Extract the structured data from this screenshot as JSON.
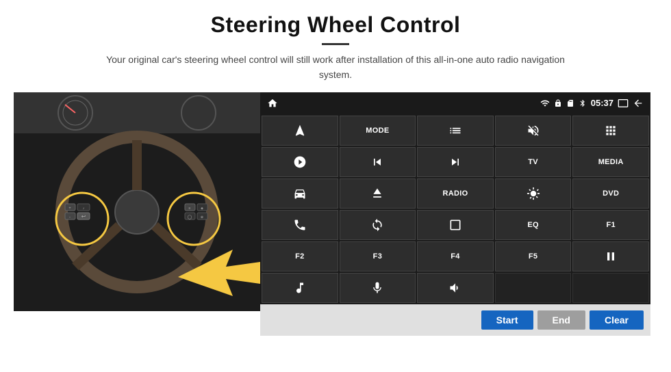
{
  "header": {
    "title": "Steering Wheel Control",
    "divider": true,
    "subtitle": "Your original car's steering wheel control will still work after installation of this all-in-one auto radio navigation system."
  },
  "status_bar": {
    "home_icon": "⌂",
    "wifi_icon": "▲",
    "lock_icon": "🔒",
    "sd_icon": "▣",
    "bt_icon": "₿",
    "time": "05:37",
    "screen_icon": "▬",
    "back_icon": "↩"
  },
  "button_rows": [
    [
      {
        "type": "icon",
        "icon": "navigate",
        "label": ""
      },
      {
        "type": "text",
        "label": "MODE"
      },
      {
        "type": "icon",
        "icon": "list",
        "label": ""
      },
      {
        "type": "icon",
        "icon": "mute",
        "label": ""
      },
      {
        "type": "icon",
        "icon": "apps",
        "label": ""
      }
    ],
    [
      {
        "type": "icon",
        "icon": "settings-circle",
        "label": ""
      },
      {
        "type": "icon",
        "icon": "prev",
        "label": ""
      },
      {
        "type": "icon",
        "icon": "next",
        "label": ""
      },
      {
        "type": "text",
        "label": "TV"
      },
      {
        "type": "text",
        "label": "MEDIA"
      }
    ],
    [
      {
        "type": "icon",
        "icon": "360-car",
        "label": ""
      },
      {
        "type": "icon",
        "icon": "eject",
        "label": ""
      },
      {
        "type": "text",
        "label": "RADIO"
      },
      {
        "type": "icon",
        "icon": "brightness",
        "label": ""
      },
      {
        "type": "text",
        "label": "DVD"
      }
    ],
    [
      {
        "type": "icon",
        "icon": "phone",
        "label": ""
      },
      {
        "type": "icon",
        "icon": "circle-arrow",
        "label": ""
      },
      {
        "type": "icon",
        "icon": "rectangle",
        "label": ""
      },
      {
        "type": "text",
        "label": "EQ"
      },
      {
        "type": "text",
        "label": "F1"
      }
    ],
    [
      {
        "type": "text",
        "label": "F2"
      },
      {
        "type": "text",
        "label": "F3"
      },
      {
        "type": "text",
        "label": "F4"
      },
      {
        "type": "text",
        "label": "F5"
      },
      {
        "type": "icon",
        "icon": "play-pause",
        "label": ""
      }
    ],
    [
      {
        "type": "icon",
        "icon": "music",
        "label": ""
      },
      {
        "type": "icon",
        "icon": "mic",
        "label": ""
      },
      {
        "type": "icon",
        "icon": "vol-phone",
        "label": ""
      },
      {
        "type": "empty",
        "label": ""
      },
      {
        "type": "empty",
        "label": ""
      }
    ]
  ],
  "action_bar": {
    "start_label": "Start",
    "end_label": "End",
    "clear_label": "Clear"
  }
}
